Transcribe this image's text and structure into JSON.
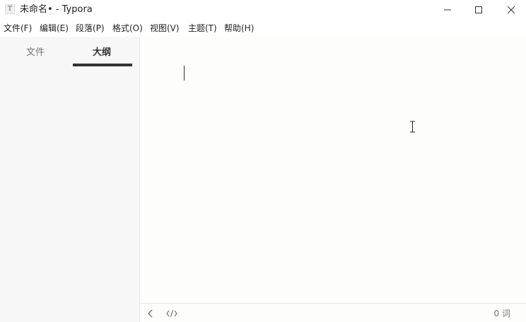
{
  "window": {
    "title": "未命名• - Typora",
    "app_icon_glyph": "T",
    "controls": [
      "minimize-icon",
      "maximize-icon",
      "close-icon"
    ]
  },
  "menubar": {
    "items": [
      {
        "label": "文件(F)"
      },
      {
        "label": "编辑(E)"
      },
      {
        "label": "段落(P)"
      },
      {
        "label": "格式(O)"
      },
      {
        "label": "视图(V)"
      },
      {
        "label": "主题(T)"
      },
      {
        "label": "帮助(H)"
      }
    ]
  },
  "sidebar": {
    "tabs": [
      {
        "label": "文件",
        "active": false
      },
      {
        "label": "大纲",
        "active": true
      }
    ]
  },
  "editor": {
    "content": ""
  },
  "statusbar": {
    "icons": [
      "chevron-left-icon",
      "source-code-icon"
    ],
    "word_count": "0 词"
  },
  "colors": {
    "background": "#fdfdfc",
    "sidebar_background": "#f7f7f7",
    "text": "#333333",
    "muted_text": "#777777"
  }
}
